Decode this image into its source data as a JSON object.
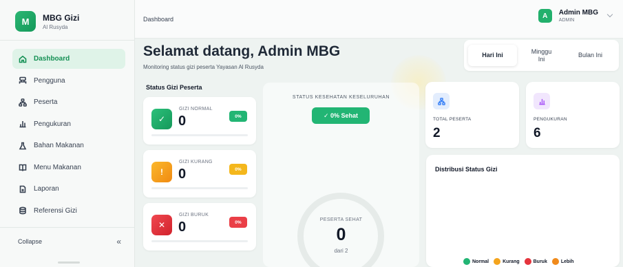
{
  "brand": {
    "logo_letter": "M",
    "name": "MBG Gizi",
    "subtitle": "Al Rusyda",
    "color": "#22b06c"
  },
  "sidebar": {
    "items": [
      {
        "label": "Dashboard",
        "icon": "home-icon",
        "active": true
      },
      {
        "label": "Pengguna",
        "icon": "users-icon"
      },
      {
        "label": "Peserta",
        "icon": "org-chart-icon"
      },
      {
        "label": "Pengukuran",
        "icon": "bar-chart-icon"
      },
      {
        "label": "Bahan Makanan",
        "icon": "flask-icon"
      },
      {
        "label": "Menu Makanan",
        "icon": "book-icon"
      },
      {
        "label": "Laporan",
        "icon": "file-icon"
      },
      {
        "label": "Referensi Gizi",
        "icon": "database-icon"
      }
    ],
    "collapse_label": "Collapse",
    "collapse_icon": "double-chevron-left-icon"
  },
  "header": {
    "breadcrumb": "Dashboard",
    "user": {
      "avatar_letter": "A",
      "name": "Admin MBG",
      "role": "ADMIN"
    }
  },
  "main": {
    "title": "Selamat datang, Admin MBG",
    "subtitle": "Monitoring status gizi peserta Yayasan Al Rusyda",
    "period": {
      "options": [
        "Hari Ini",
        "Minggu Ini",
        "Bulan Ini"
      ],
      "selected": "Hari Ini"
    },
    "status_section_label": "Status Gizi Peserta",
    "status_cards": [
      {
        "label": "GIZI NORMAL",
        "value": "0",
        "badge": "0%",
        "icon": "check-icon",
        "icon_glyph": "✓",
        "color": "#22b06c",
        "progress": 0
      },
      {
        "label": "GIZI KURANG",
        "value": "0",
        "badge": "0%",
        "icon": "alert-icon",
        "icon_glyph": "!",
        "color": "#f4a41c",
        "progress": 0
      },
      {
        "label": "GIZI BURUK",
        "value": "0",
        "badge": "0%",
        "icon": "x-icon",
        "icon_glyph": "✕",
        "color": "#e5343d",
        "progress": 0
      }
    ],
    "health": {
      "label": "STATUS KESEHATAN KESELURUHAN",
      "pill": "✓ 0% Sehat",
      "ring_label": "PESERTA SEHAT",
      "ring_value": "0",
      "ring_sub": "dari 2"
    },
    "totals": [
      {
        "label": "TOTAL PESERTA",
        "value": "2",
        "icon": "org-chart-icon",
        "color": "#3b82f6",
        "bg": "#e3edfd"
      },
      {
        "label": "PENGUKURAN",
        "value": "6",
        "icon": "bar-chart-icon",
        "color": "#a855f7",
        "bg": "#f1e6fd"
      }
    ],
    "distribution": {
      "title": "Distribusi Status Gizi",
      "legend": [
        {
          "label": "Normal",
          "color": "#22b574"
        },
        {
          "label": "Kurang",
          "color": "#f4a41c"
        },
        {
          "label": "Buruk",
          "color": "#e5343d"
        },
        {
          "label": "Lebih",
          "color": "#f08a1c"
        }
      ]
    }
  }
}
